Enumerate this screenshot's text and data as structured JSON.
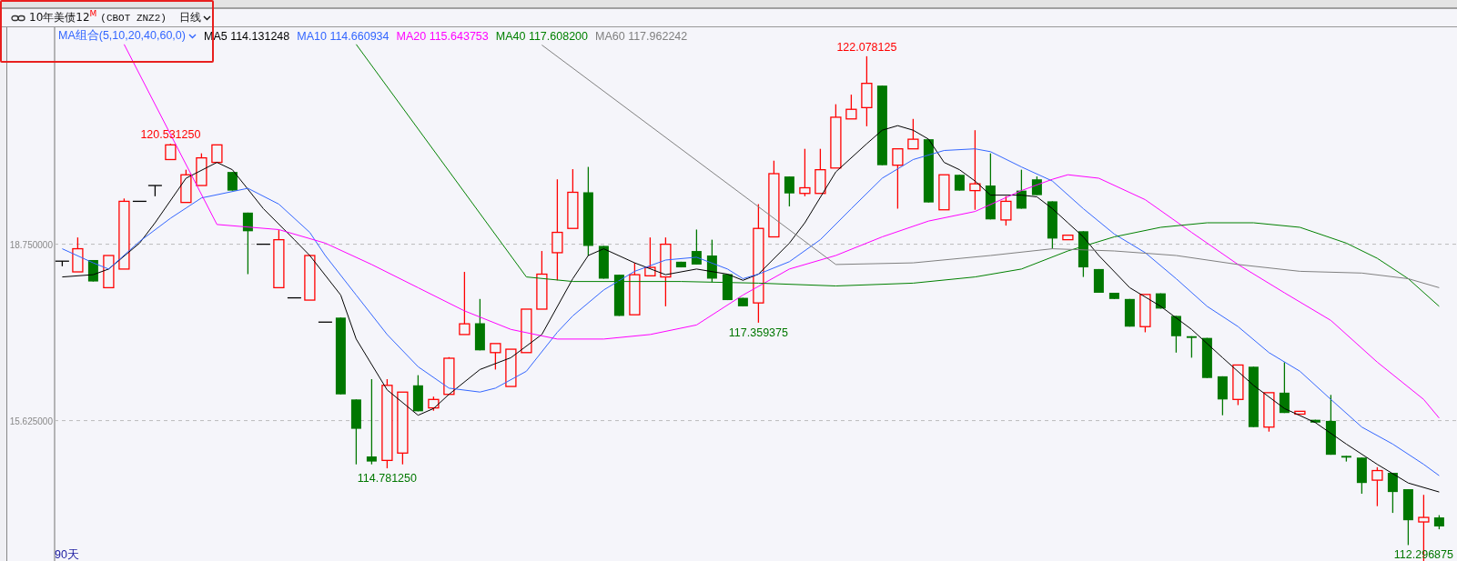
{
  "header": {
    "instrument": "10年美债12$^{M}$",
    "contract": "(CBOT ZNZ2)",
    "period": "日线"
  },
  "legend": {
    "combo": "MA组合(5,10,20,40,60,0)",
    "entries": [
      {
        "label": "MA5 114.131248",
        "color": "#000000"
      },
      {
        "label": "MA10 114.660934",
        "color": "#3366ff"
      },
      {
        "label": "MA20 115.643753",
        "color": "#ff00ff"
      },
      {
        "label": "MA40 117.608200",
        "color": "#008000"
      },
      {
        "label": "MA60 117.962242",
        "color": "#808080"
      }
    ]
  },
  "axis_labels": [
    "18.750000",
    "15.625000"
  ],
  "price_labels": [
    {
      "label": "120.531250",
      "kind": "high"
    },
    {
      "label": "114.781250",
      "kind": "low"
    },
    {
      "label": "117.359375",
      "kind": "low"
    },
    {
      "label": "122.078125",
      "kind": "high"
    },
    {
      "label": "112.296875",
      "kind": "low"
    }
  ],
  "period_count": "90天"
}
